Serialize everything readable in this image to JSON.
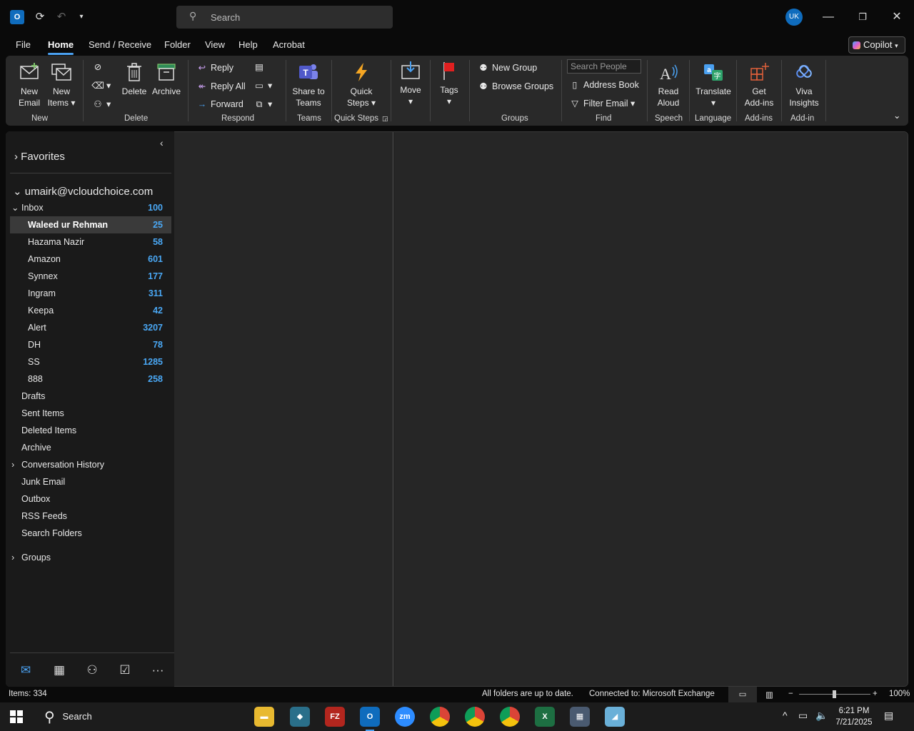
{
  "titlebar": {
    "search_placeholder": "Search",
    "avatar_initials": "UK"
  },
  "tabs": [
    "File",
    "Home",
    "Send / Receive",
    "Folder",
    "View",
    "Help",
    "Acrobat"
  ],
  "active_tab": "Home",
  "copilot_label": "Copilot",
  "ribbon": {
    "new_email": [
      "New",
      "Email"
    ],
    "new_items": [
      "New",
      "Items"
    ],
    "group_new": "New",
    "delete": "Delete",
    "archive": "Archive",
    "group_delete": "Delete",
    "reply": "Reply",
    "reply_all": "Reply All",
    "forward": "Forward",
    "group_respond": "Respond",
    "share_teams": [
      "Share to",
      "Teams"
    ],
    "group_teams": "Teams",
    "quick_steps": [
      "Quick",
      "Steps"
    ],
    "group_quick_steps": "Quick Steps",
    "move": "Move",
    "tags": "Tags",
    "new_group": "New Group",
    "browse_groups": "Browse Groups",
    "group_groups": "Groups",
    "search_people_placeholder": "Search People",
    "address_book": "Address Book",
    "filter_email": "Filter Email",
    "group_find": "Find",
    "read_aloud": [
      "Read",
      "Aloud"
    ],
    "group_speech": "Speech",
    "translate": "Translate",
    "group_language": "Language",
    "get_addins": [
      "Get",
      "Add-ins"
    ],
    "group_addins": "Add-ins",
    "viva": [
      "Viva",
      "Insights"
    ],
    "group_addin": "Add-in"
  },
  "folders": {
    "favorites": "Favorites",
    "account": "umairk@vcloudchoice.com",
    "inbox": {
      "name": "Inbox",
      "count": "100"
    },
    "subfolders": [
      {
        "name": "Waleed ur Rehman",
        "count": "25"
      },
      {
        "name": "Hazama Nazir",
        "count": "58"
      },
      {
        "name": "Amazon",
        "count": "601"
      },
      {
        "name": "Synnex",
        "count": "177"
      },
      {
        "name": "Ingram",
        "count": "311"
      },
      {
        "name": "Keepa",
        "count": "42"
      },
      {
        "name": "Alert",
        "count": "3207"
      },
      {
        "name": "DH",
        "count": "78"
      },
      {
        "name": "SS",
        "count": "1285"
      },
      {
        "name": "888",
        "count": "258"
      }
    ],
    "others": [
      "Drafts",
      "Sent Items",
      "Deleted Items",
      "Archive",
      "Conversation History",
      "Junk Email",
      "Outbox",
      "RSS Feeds",
      "Search Folders"
    ],
    "groups": "Groups"
  },
  "status": {
    "items": "Items: 334",
    "sync": "All folders are up to date.",
    "connection": "Connected to: Microsoft Exchange",
    "zoom": "100%",
    "zoom_level": 0.5
  },
  "taskbar": {
    "search_label": "Search",
    "time": "6:21 PM",
    "date": "7/21/2025"
  }
}
